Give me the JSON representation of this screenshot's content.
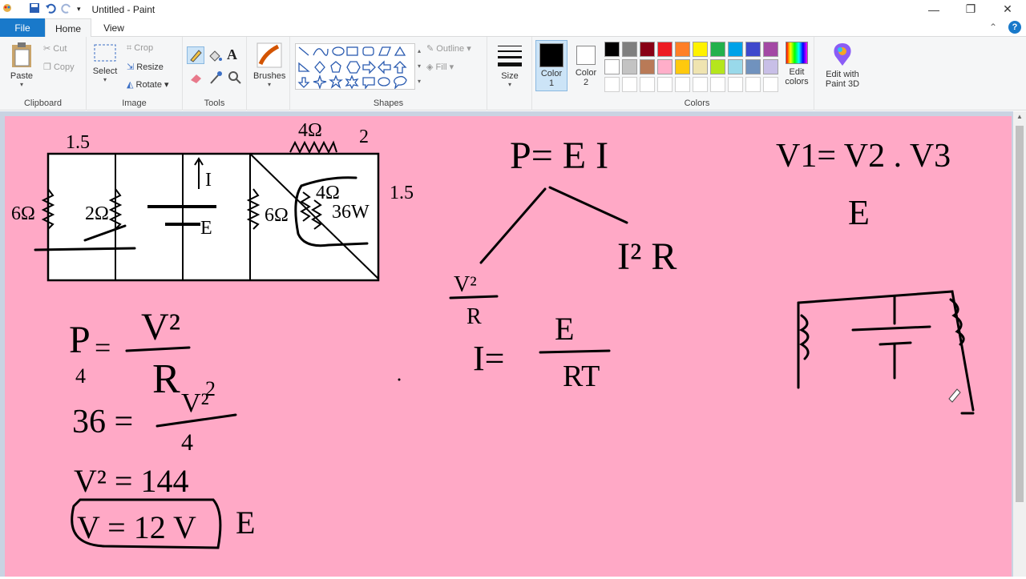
{
  "window": {
    "title": "Untitled - Paint"
  },
  "tabs": {
    "file": "File",
    "home": "Home",
    "view": "View"
  },
  "clipboard": {
    "paste": "Paste",
    "cut": "Cut",
    "copy": "Copy",
    "label": "Clipboard"
  },
  "image": {
    "select": "Select",
    "crop": "Crop",
    "resize": "Resize",
    "rotate": "Rotate",
    "label": "Image"
  },
  "tools": {
    "label": "Tools",
    "text_tool": "A"
  },
  "brushes": {
    "label": "Brushes"
  },
  "shapes": {
    "outline": "Outline",
    "fill": "Fill",
    "label": "Shapes"
  },
  "size": {
    "label": "Size"
  },
  "colors": {
    "color1": "Color\n1",
    "color1_a": "Color",
    "color1_b": "1",
    "color2_a": "Color",
    "color2_b": "2",
    "edit_a": "Edit",
    "edit_b": "colors",
    "paint3d_a": "Edit with",
    "paint3d_b": "Paint 3D",
    "label": "Colors",
    "palette_row1": [
      "#000000",
      "#7f7f7f",
      "#880015",
      "#ed1c24",
      "#ff7f27",
      "#fff200",
      "#22b14c",
      "#00a2e8",
      "#3f48cc",
      "#a349a4"
    ],
    "palette_row2": [
      "#ffffff",
      "#c3c3c3",
      "#b97a57",
      "#ffaec9",
      "#ffc90e",
      "#efe4b0",
      "#b5e61d",
      "#99d9ea",
      "#7092be",
      "#c8bfe7"
    ],
    "canvas_bg": "#ffa9c6"
  },
  "drawing": {
    "circuit": {
      "top_left": "1.5",
      "top_resistor": "4Ω",
      "top_right": "2",
      "r_left": "6Ω",
      "r_2": "2Ω",
      "current": "I",
      "emf": "E",
      "r_6": "6Ω",
      "r_4": "4Ω",
      "power": "36W",
      "side": "1.5"
    },
    "formulas": {
      "p_ei": "P= E I",
      "i2r": "I² R",
      "v2r_top": "V²",
      "v2r_bot": "R",
      "i_eq": "I=",
      "i_num": "E",
      "i_den": "RT",
      "v_eq": "V1= V2 . V3",
      "e_right": "E",
      "p_left": "P",
      "p_sub": "4",
      "p_eq": "=",
      "p_num": "V²",
      "p_den": "R",
      "p_den_sub": "2",
      "l2_lhs": "36 =",
      "l2_num": "V²",
      "l2_den": "4",
      "l3": "V² = 144",
      "l4": "V = 12 V",
      "l4_e": "E"
    }
  }
}
